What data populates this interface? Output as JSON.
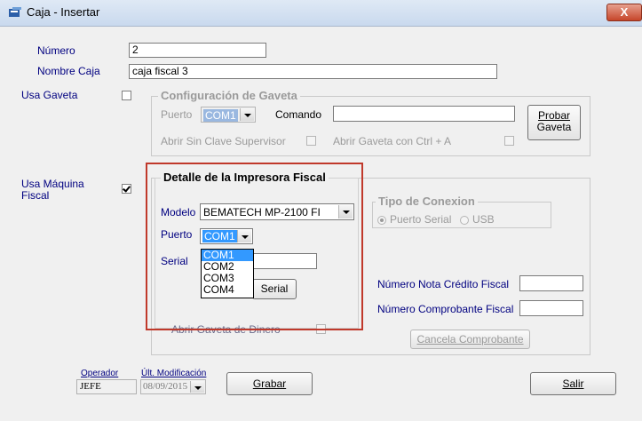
{
  "window": {
    "title": "Caja - Insertar",
    "close_label": "X"
  },
  "form": {
    "numero_label": "Número",
    "numero_value": "2",
    "nombre_label": "Nombre Caja",
    "nombre_value": "caja fiscal 3",
    "usa_gaveta_label": "Usa Gaveta",
    "usa_maquina_label_1": "Usa Máquina",
    "usa_maquina_label_2": "Fiscal"
  },
  "gaveta": {
    "title": "Configuración de Gaveta",
    "puerto_label": "Puerto",
    "puerto_value": "COM1",
    "comando_label": "Comando",
    "comando_value": "",
    "probar_label_1": "Probar",
    "probar_label_2": "Gaveta",
    "sin_clave_label": "Abrir Sin Clave Supervisor",
    "ctrl_a_label": "Abrir Gaveta con Ctrl + A"
  },
  "impresora": {
    "title": "Detalle de la Impresora Fiscal",
    "modelo_label": "Modelo",
    "modelo_value": "BEMATECH MP-2100 FI",
    "puerto_label": "Puerto",
    "puerto_value": "COM1",
    "puerto_options": [
      "COM1",
      "COM2",
      "COM3",
      "COM4"
    ],
    "serial_label": "Serial",
    "serial_value": "",
    "serial_button": "Serial",
    "abrir_gaveta_label": "Abrir Gaveta de Dinero"
  },
  "conexion": {
    "title": "Tipo de Conexion",
    "serial_label": "Puerto Serial",
    "usb_label": "USB"
  },
  "fiscal": {
    "nota_credito_label": "Número Nota Crédito Fiscal",
    "nota_credito_value": "",
    "comprobante_label": "Número Comprobante Fiscal",
    "comprobante_value": "",
    "cancela_label": "Cancela Comprobante"
  },
  "footer": {
    "operador_label": "Operador",
    "operador_value": "JEFE",
    "ult_mod_label": "Últ. Modificación",
    "ult_mod_value": "08/09/2015",
    "grabar_label": "Grabar",
    "salir_label": "Salir"
  }
}
